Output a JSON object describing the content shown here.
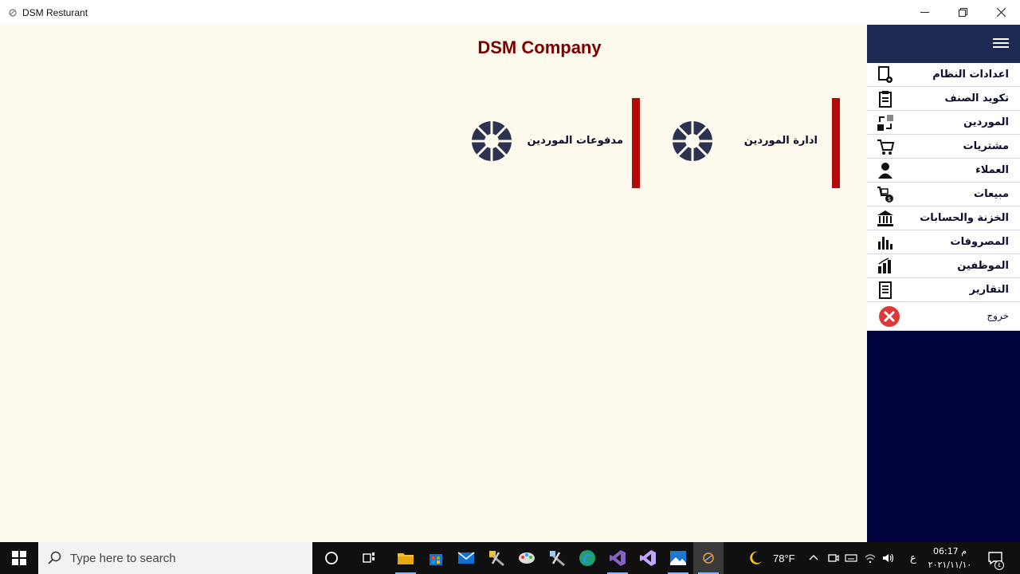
{
  "window": {
    "title": "DSM Resturant"
  },
  "main": {
    "company": "DSM Company",
    "tiles": [
      {
        "label": "ادارة الموردين"
      },
      {
        "label": "مدفوعات الموردين"
      }
    ]
  },
  "sidebar": {
    "items": [
      {
        "label": "اعدادات النظام",
        "icon": "settings-doc-icon"
      },
      {
        "label": "تكويد الصنف",
        "icon": "clipboard-icon"
      },
      {
        "label": "الموردين",
        "icon": "transfer-icon"
      },
      {
        "label": "مشتريات",
        "icon": "cart-icon"
      },
      {
        "label": "العملاء",
        "icon": "user-icon"
      },
      {
        "label": "مبيعات",
        "icon": "sales-cart-icon"
      },
      {
        "label": "الخزنة والحسابات",
        "icon": "bank-icon"
      },
      {
        "label": "المصروفات",
        "icon": "bar-chart-icon"
      },
      {
        "label": "الموظفين",
        "icon": "employees-icon"
      },
      {
        "label": "التقارير",
        "icon": "report-icon"
      }
    ],
    "exit": {
      "label": "خروج",
      "icon": "close-circle-icon"
    }
  },
  "taskbar": {
    "search_placeholder": "Type here to search",
    "weather": "78°F",
    "lang": "ع",
    "time": "06:17 م",
    "date": "٢٠٢١/١١/١٠",
    "notifications_count": "٤"
  },
  "colors": {
    "sidebar_bg": "#02043f",
    "sidebar_header": "#1c2a52",
    "accent_bar": "#b30a0a",
    "company_title": "#7a0000",
    "main_bg": "#fef9ed"
  }
}
